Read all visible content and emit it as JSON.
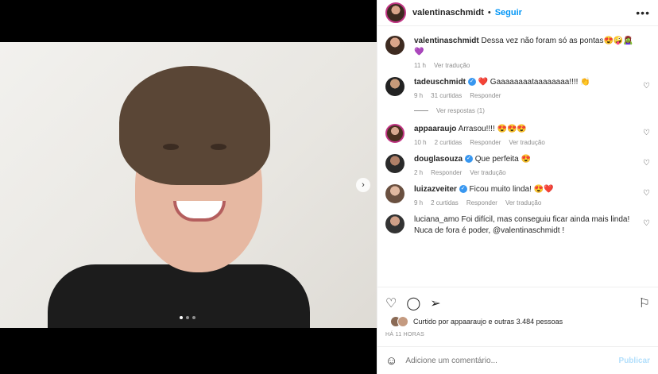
{
  "post": {
    "username": "valentinaschmidt",
    "separator": "•",
    "follow_label": "Seguir",
    "more_icon": "more-icon"
  },
  "caption": {
    "username": "valentinaschmidt",
    "text": "Dessa vez não foram só as pontas😍🤪🧟‍♀️💜",
    "time": "11 h",
    "translate": "Ver tradução"
  },
  "comments": [
    {
      "username": "tadeuschmidt",
      "verified": true,
      "text": "❤️ Gaaaaaaaataaaaaaaa!!!! 👏",
      "time": "9 h",
      "likes": "31 curtidas",
      "reply": "Responder",
      "translate": ""
    },
    {
      "username": "appaaraujo",
      "verified": false,
      "text": "Arrasou!!!! 😍😍😍",
      "time": "10 h",
      "likes": "2 curtidas",
      "reply": "Responder",
      "translate": "Ver tradução"
    },
    {
      "username": "douglasouza",
      "verified": true,
      "text": "Que perfeita 😍",
      "time": "2 h",
      "likes": "",
      "reply": "Responder",
      "translate": "Ver tradução"
    },
    {
      "username": "luizazveiter",
      "verified": true,
      "text": "Ficou muito linda! 😍❤️",
      "time": "9 h",
      "likes": "2 curtidas",
      "reply": "Responder",
      "translate": "Ver tradução"
    },
    {
      "username": "luciana_amo",
      "verified": false,
      "text": "Foi difícil, mas conseguiu ficar ainda mais linda! Nuca de fora é poder, @valentinaschmidt !",
      "time": "",
      "likes": "",
      "reply": "",
      "translate": ""
    }
  ],
  "view_replies": "Ver respostas (1)",
  "liked_by": "Curtido por appaaraujo e outras 3.484 pessoas",
  "timestamp": "HÁ 11 HORAS",
  "add_comment": {
    "placeholder": "Adicione um comentário...",
    "post_label": "Publicar"
  },
  "colors": {
    "accent": "#0095f6",
    "heart": "#ed4956",
    "verified": "#3897f0"
  }
}
